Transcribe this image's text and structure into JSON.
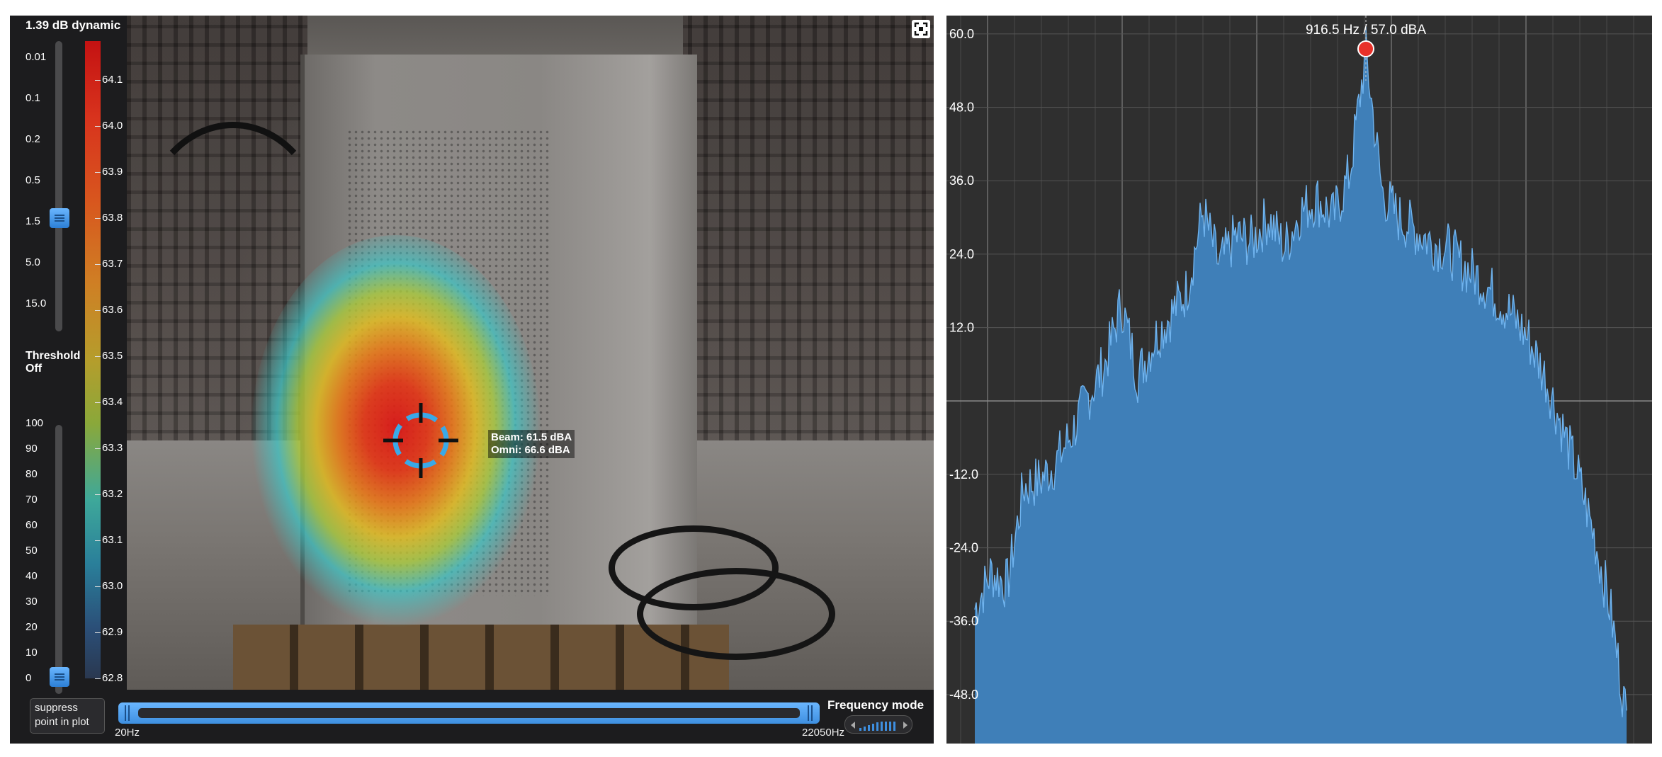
{
  "controls": {
    "dynamic_title": "1.39 dB dynamic",
    "dynamic_ticks": [
      "0.01",
      "0.1",
      "0.2",
      "0.5",
      "1.5",
      "5.0",
      "15.0"
    ],
    "dynamic_value": 1.5,
    "threshold_label_line1": "Threshold",
    "threshold_label_line2": "Off",
    "threshold_ticks": [
      "100",
      "90",
      "80",
      "70",
      "60",
      "50",
      "40",
      "30",
      "20",
      "10",
      "0"
    ],
    "threshold_value": 0
  },
  "colorbar": {
    "ticks": [
      "64.1",
      "64.0",
      "63.9",
      "63.8",
      "63.7",
      "63.6",
      "63.5",
      "63.4",
      "63.3",
      "63.2",
      "63.1",
      "63.0",
      "62.9",
      "62.8"
    ]
  },
  "measurement": {
    "beam": "Beam: 61.5 dBA",
    "omni": "Omni: 66.6 dBA"
  },
  "bottom": {
    "suppress_line1": "suppress",
    "suppress_line2": "point in plot",
    "freq_min": "20Hz",
    "freq_max": "22050Hz",
    "freq_mode_label": "Frequency mode"
  },
  "icons": {
    "fullscreen": "fullscreen-icon",
    "target": "crosshair-icon",
    "peak_marker": "peak-marker-icon",
    "slider_grip": "grip-icon"
  },
  "colors": {
    "accent": "#4a9eea",
    "spectrum_fill": "#3f7fb8",
    "spectrum_edge": "#6fb3ee",
    "peak_marker": "#e8312a",
    "panel_bg": "#2f2f2f"
  },
  "chart_data": {
    "type": "area",
    "title": "",
    "xlabel": "",
    "ylabel": "",
    "peak_label": "916.5 Hz / 57.0 dBA",
    "peak_value": 57.0,
    "ylim": [
      -56,
      63
    ],
    "y_ticks": [
      60.0,
      48.0,
      36.0,
      24.0,
      12.0,
      -12.0,
      -24.0,
      -36.0,
      -48.0
    ],
    "y_tick_labels": [
      "60.0",
      "48.0",
      "36.0",
      "24.0",
      "12.0",
      "-12.0",
      "-24.0",
      "-36.0",
      "-48.0"
    ],
    "grid": true,
    "x": [
      0,
      1,
      2,
      3,
      4,
      5,
      6,
      7,
      8,
      9,
      10,
      11,
      12,
      13,
      14,
      15,
      16,
      17,
      18,
      19,
      20,
      21,
      22,
      23,
      24,
      25,
      26,
      27,
      28,
      29,
      30,
      31,
      32,
      33,
      34,
      35,
      36,
      37,
      38,
      39,
      40
    ],
    "series": [
      {
        "values": [
          -34,
          -28,
          -30,
          -14,
          -13,
          -10,
          -5,
          1,
          6,
          16,
          4,
          10,
          14,
          18,
          31,
          22,
          27,
          26,
          30,
          25,
          31,
          33,
          30,
          37,
          57,
          34,
          30,
          28,
          26,
          25,
          22,
          20,
          17,
          14,
          10,
          4,
          -4,
          -12,
          -22,
          -34,
          -52
        ]
      }
    ]
  }
}
